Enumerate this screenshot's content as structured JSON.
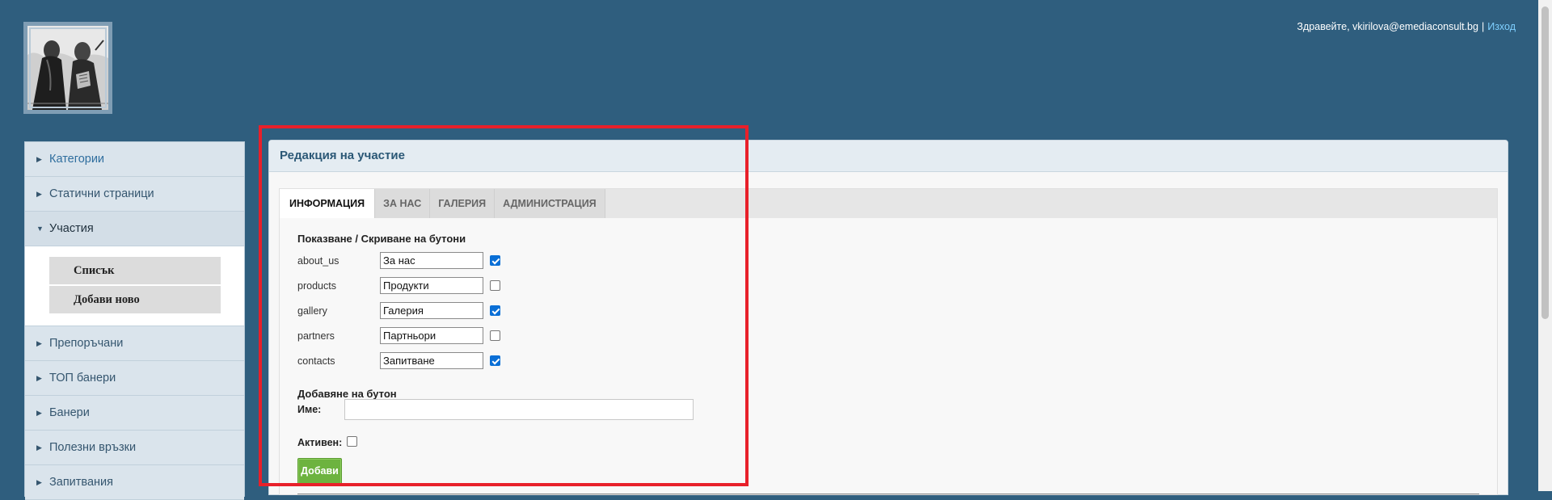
{
  "header": {
    "greeting": "Здравейте, vkirilova@emediaconsult.bg",
    "separator": "|",
    "logout_label": "Изход",
    "logo_icon": "portrait-logo-icon"
  },
  "sidebar": {
    "items_top": [
      {
        "label": "Категории"
      },
      {
        "label": "Статични страници"
      },
      {
        "label": "Участия"
      }
    ],
    "submenu": [
      {
        "label": "Списък"
      },
      {
        "label": "Добави ново"
      }
    ],
    "items_bottom": [
      {
        "label": "Препоръчани"
      },
      {
        "label": "ТОП банери"
      },
      {
        "label": "Банери"
      },
      {
        "label": "Полезни връзки"
      },
      {
        "label": "Запитвания"
      }
    ]
  },
  "panel": {
    "title": "Редакция на участие",
    "tabs": [
      {
        "label": "ИНФОРМАЦИЯ",
        "active": true
      },
      {
        "label": "ЗА НАС",
        "active": false
      },
      {
        "label": "ГАЛЕРИЯ",
        "active": false
      },
      {
        "label": "АДМИНИСТРАЦИЯ",
        "active": false
      }
    ],
    "buttons_section_title": "Показване / Скриване на бутони",
    "buttons": [
      {
        "key": "about_us",
        "value": "За нас",
        "checked": true
      },
      {
        "key": "products",
        "value": "Продукти",
        "checked": false
      },
      {
        "key": "gallery",
        "value": "Галерия",
        "checked": true
      },
      {
        "key": "partners",
        "value": "Партньори",
        "checked": false
      },
      {
        "key": "contacts",
        "value": "Запитване",
        "checked": true
      }
    ],
    "add_section_title": "Добавяне на бутон",
    "name_label": "Име:",
    "name_value": "",
    "active_label": "Активен:",
    "active_checked": false,
    "add_button_label": "Добави"
  },
  "colors": {
    "page_background": "#2f5e7e",
    "highlight_border": "#e8202a",
    "add_button": "#6db33f",
    "panel_title": "#2b5876",
    "logout_link": "#7fd0ff"
  }
}
